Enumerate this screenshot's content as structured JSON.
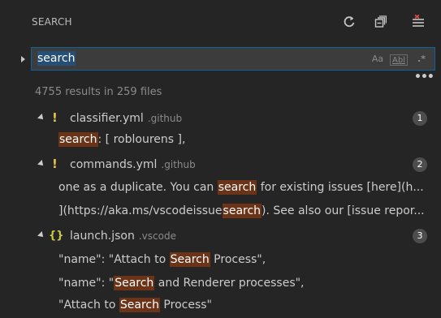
{
  "header": {
    "title": "SEARCH"
  },
  "search": {
    "query": "search",
    "options": {
      "match_case": "Aa",
      "whole_word": "Abl",
      "regex": ".*"
    }
  },
  "summary": "4755 results in 259 files",
  "results": [
    {
      "file": "classifier.yml",
      "dir": ".github",
      "icon": "exclamation-icon",
      "count": "1",
      "matches": [
        {
          "before": "",
          "match": "search",
          "after": ": [ roblourens ],"
        }
      ]
    },
    {
      "file": "commands.yml",
      "dir": ".github",
      "icon": "exclamation-icon",
      "count": "2",
      "matches": [
        {
          "before": "one as a duplicate. You can ",
          "match": "search",
          "after": " for existing issues [here](h..."
        },
        {
          "before": "](https://aka.ms/vscodeissue",
          "match": "search",
          "after": "). See also our [issue repor..."
        }
      ]
    },
    {
      "file": "launch.json",
      "dir": ".vscode",
      "icon": "braces-icon",
      "count": "3",
      "matches": [
        {
          "before": "\"name\": \"Attach to ",
          "match": "Search",
          "after": " Process\","
        },
        {
          "before": "\"name\": \"",
          "match": "Search",
          "after": " and Renderer processes\","
        },
        {
          "before": "\"Attach to ",
          "match": "Search",
          "after": " Process\""
        }
      ]
    }
  ]
}
